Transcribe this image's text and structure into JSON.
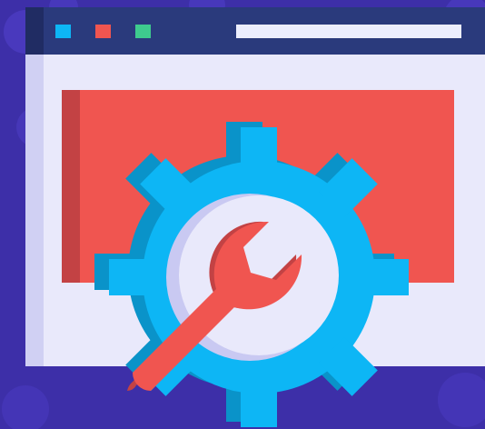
{
  "illustration": {
    "subject": "browser-window-settings",
    "icons": [
      "browser-window-icon",
      "gear-icon",
      "wrench-icon"
    ],
    "window_dots": [
      "#0db6f5",
      "#f05550",
      "#3ecb8e"
    ]
  },
  "colors": {
    "background": "#3d2fa8",
    "background_blob": "#4a3bbf",
    "window_title_bar": "#2a3a7c",
    "window_title_bar_dark": "#202c63",
    "window_body": "#e9e9fb",
    "window_body_shade": "#d0d0f3",
    "window_address_bar": "#eceefe",
    "content_block": "#f05550",
    "content_block_shade": "#c34244",
    "gear": "#0db6f5",
    "gear_shade": "#0a93c9",
    "gear_hole": "#e9e9fb",
    "gear_hole_shade": "#c9c9f2",
    "wrench": "#f05550",
    "wrench_shade": "#c34244"
  }
}
